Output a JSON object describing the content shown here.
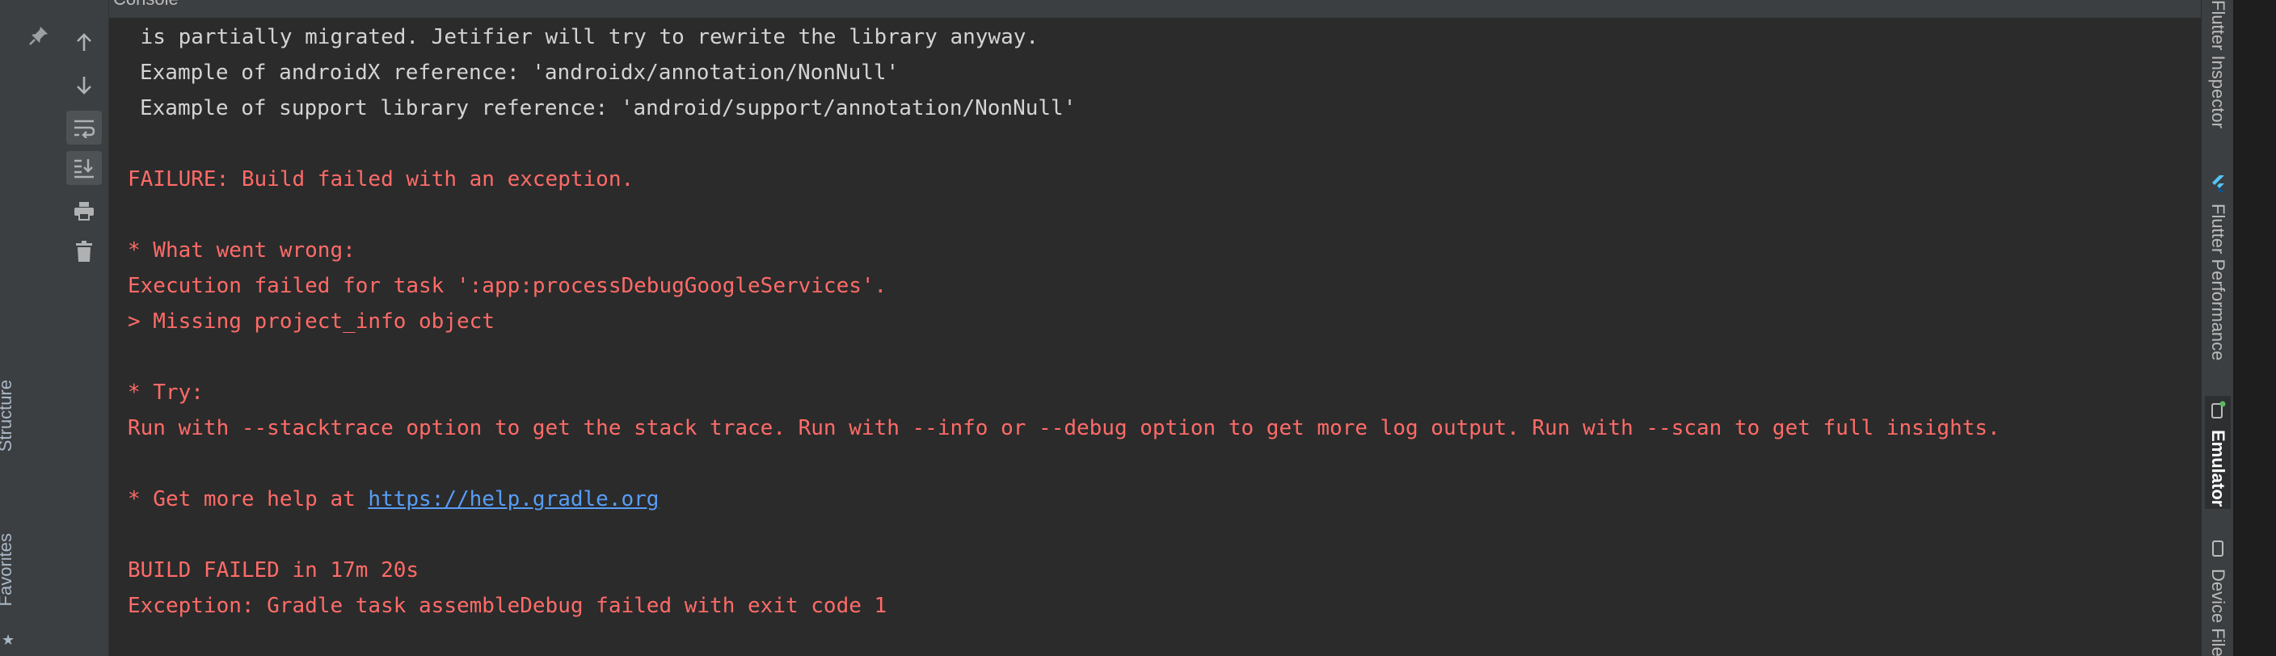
{
  "top_tab": {
    "label": "Console"
  },
  "left_strip": {
    "labels": [
      "Structure",
      "Favorites"
    ]
  },
  "toolbar": {
    "buttons": [
      {
        "icon": "arrow-up-icon"
      },
      {
        "icon": "arrow-down-icon"
      },
      {
        "icon": "soft-wrap-icon"
      },
      {
        "icon": "scroll-to-end-icon"
      },
      {
        "icon": "print-icon"
      },
      {
        "icon": "trash-icon"
      }
    ]
  },
  "console": {
    "lines": [
      {
        "text": " is partially migrated. Jetifier will try to rewrite the library anyway.",
        "style": "plain"
      },
      {
        "text": "Example of androidX reference: 'androidx/annotation/NonNull'",
        "style": "plain"
      },
      {
        "text": "Example of support library reference: 'android/support/annotation/NonNull'",
        "style": "plain"
      },
      {
        "text": "FAILURE: Build failed with an exception.",
        "style": "err"
      },
      {
        "text": "* What went wrong:",
        "style": "err"
      },
      {
        "text": "Execution failed for task ':app:processDebugGoogleServices'.",
        "style": "err"
      },
      {
        "text": "> Missing project_info object",
        "style": "err"
      },
      {
        "text": "* Try:",
        "style": "err"
      },
      {
        "text": "Run with --stacktrace option to get the stack trace. Run with --info or --debug option to get more log output. Run with --scan to get full insights.",
        "style": "err"
      },
      {
        "prefix": "* Get more help at ",
        "link": "https://help.gradle.org",
        "style": "err"
      },
      {
        "text": "BUILD FAILED in 17m 20s",
        "style": "err"
      },
      {
        "text": "Exception: Gradle task assembleDebug failed with exit code 1",
        "style": "err"
      }
    ]
  },
  "right_strip": {
    "tabs": [
      {
        "label": "Flutter Inspector",
        "icon": "flutter-inspector-icon"
      },
      {
        "label": "Flutter Performance",
        "icon": "flutter-icon"
      },
      {
        "label": "Emulator",
        "icon": "emulator-icon",
        "active": true
      },
      {
        "label": "Device File",
        "icon": "device-icon"
      }
    ]
  }
}
